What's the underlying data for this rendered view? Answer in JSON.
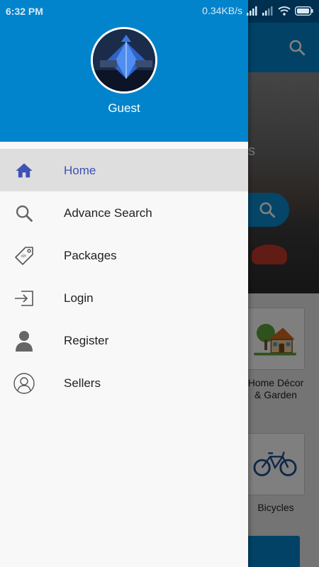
{
  "status_bar": {
    "time": "6:32 PM",
    "net_speed": "0.34KB/s"
  },
  "drawer": {
    "user_name": "Guest",
    "menu": [
      {
        "label": "Home",
        "icon": "home-icon",
        "active": true
      },
      {
        "label": "Advance Search",
        "icon": "search-icon",
        "active": false
      },
      {
        "label": "Packages",
        "icon": "price-tag-icon",
        "active": false
      },
      {
        "label": "Login",
        "icon": "login-icon",
        "active": false
      },
      {
        "label": "Register",
        "icon": "person-icon",
        "active": false
      },
      {
        "label": "Sellers",
        "icon": "user-circle-icon",
        "active": false
      }
    ]
  },
  "background_app": {
    "hero_text": "s",
    "categories": [
      {
        "label": "Home Décor & Garden",
        "icon": "house-icon"
      },
      {
        "label": "Bicycles",
        "icon": "bicycle-icon"
      }
    ]
  },
  "colors": {
    "primary": "#0284cc",
    "active_text": "#3f51b5",
    "active_bg": "#dedede"
  }
}
